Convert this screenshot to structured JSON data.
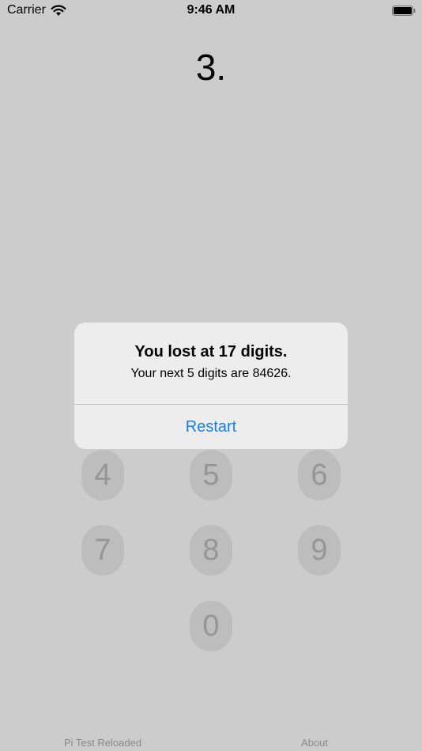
{
  "status_bar": {
    "carrier": "Carrier",
    "time": "9:46 AM",
    "wifi_icon": "wifi-icon",
    "battery_icon": "battery-full-icon"
  },
  "display": {
    "value": "3."
  },
  "keypad": {
    "keys": [
      "4",
      "5",
      "6",
      "7",
      "8",
      "9",
      "0"
    ]
  },
  "alert": {
    "title": "You lost at 17 digits.",
    "message": "Your next 5 digits are 84626.",
    "button": "Restart"
  },
  "footer": {
    "left_link": "Pi Test Reloaded",
    "right_link": "About"
  },
  "colors": {
    "background": "#cccccc",
    "alert_background": "#ededed",
    "accent": "#1a7ee0",
    "keypad_key": "#bdbdbd",
    "keypad_text": "#969696"
  }
}
